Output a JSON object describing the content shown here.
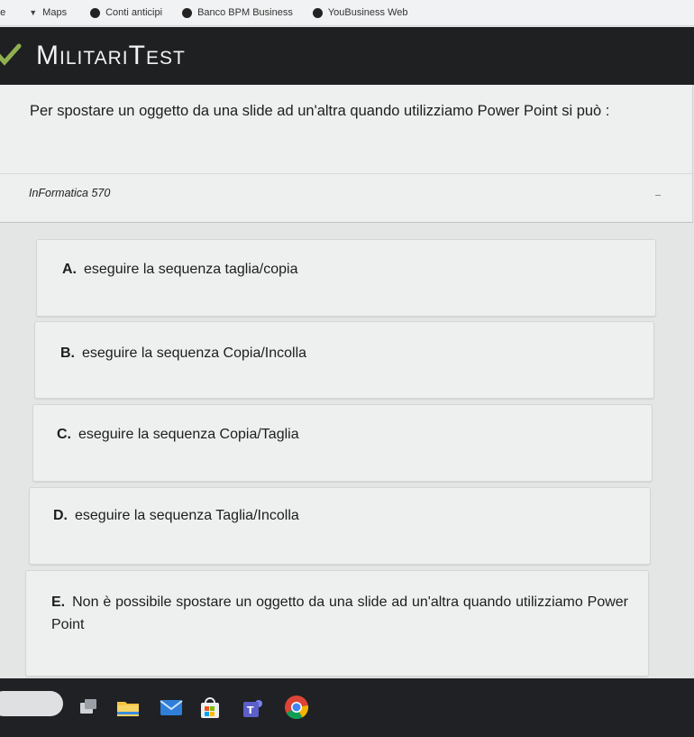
{
  "bookmarks": [
    {
      "label": "Maps",
      "icon": "map-triangle-icon"
    },
    {
      "label": "Conti anticipi",
      "icon": "bookmark-dot-icon"
    },
    {
      "label": "Banco BPM Business",
      "icon": "bookmark-dot-icon"
    },
    {
      "label": "YouBusiness Web",
      "icon": "bookmark-dot-icon"
    }
  ],
  "header": {
    "title": "MilitariTest",
    "accent": "#6b8e3e"
  },
  "question": {
    "text": "Per spostare un oggetto da una slide ad un'altra quando utilizziamo Power Point si può :",
    "category": "InFormatica 570"
  },
  "answers": [
    {
      "letter": "A.",
      "text": "eseguire la sequenza taglia/copia"
    },
    {
      "letter": "B.",
      "text": "eseguire la sequenza Copia/Incolla"
    },
    {
      "letter": "C.",
      "text": "eseguire la sequenza Copia/Taglia"
    },
    {
      "letter": "D.",
      "text": "eseguire la sequenza Taglia/Incolla"
    },
    {
      "letter": "E.",
      "text": "Non è possibile spostare un oggetto da una slide ad un'altra quando utilizziamo Power Point"
    }
  ],
  "taskbar": {
    "icons": [
      "task-view-icon",
      "file-explorer-icon",
      "mail-icon",
      "store-icon",
      "teams-icon",
      "chrome-icon"
    ]
  }
}
